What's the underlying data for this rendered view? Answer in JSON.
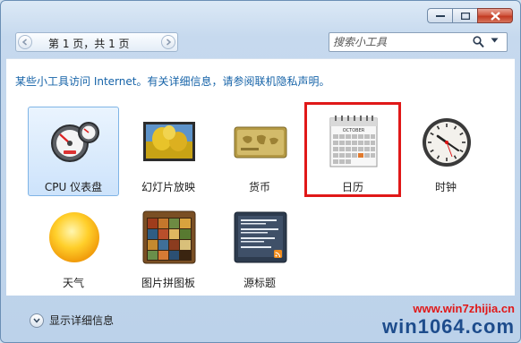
{
  "pager": {
    "text": "第 1 页，共 1 页"
  },
  "search": {
    "placeholder": "搜索小工具"
  },
  "notice": "某些小工具访问 Internet。有关详细信息，请参阅联机隐私声明。",
  "gadgets": [
    {
      "label": "CPU 仪表盘",
      "icon": "cpu-meter-icon",
      "selected": true
    },
    {
      "label": "幻灯片放映",
      "icon": "slideshow-icon"
    },
    {
      "label": "货币",
      "icon": "currency-icon"
    },
    {
      "label": "日历",
      "icon": "calendar-icon",
      "highlighted": true
    },
    {
      "label": "时钟",
      "icon": "clock-icon"
    },
    {
      "label": "天气",
      "icon": "weather-icon"
    },
    {
      "label": "图片拼图板",
      "icon": "picture-puzzle-icon"
    },
    {
      "label": "源标题",
      "icon": "feed-headlines-icon"
    }
  ],
  "calendar_month": "OCTOBER",
  "details": {
    "label": "显示详细信息"
  },
  "watermark": {
    "url": "www.win7zhijia.cn",
    "logo": "win1064.com"
  },
  "colors": {
    "accent_link": "#1663a8",
    "highlight": "#e01818"
  }
}
